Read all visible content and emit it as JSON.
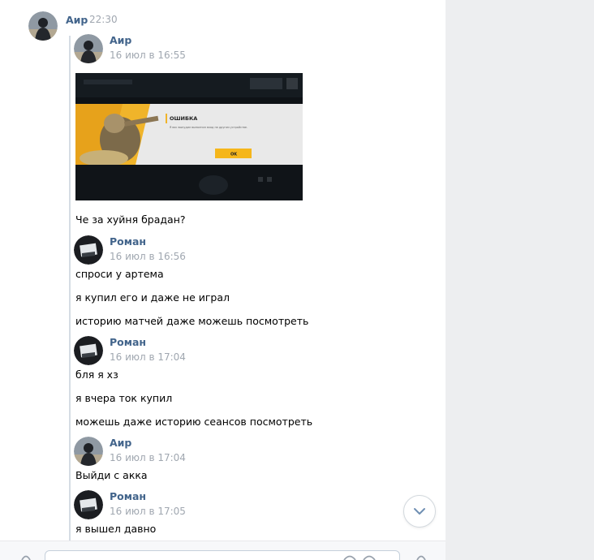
{
  "forward_header": {
    "author": "Аир",
    "time": "22:30"
  },
  "messages": [
    {
      "author": "Аир",
      "date": "16 июл в 16:55",
      "lines": [
        "Че за хуйня брадан?"
      ]
    },
    {
      "author": "Роман",
      "date": "16 июл в 16:56",
      "lines": [
        "спроси у артема",
        "я купил его и даже не играл",
        "историю матчей даже можешь посмотреть"
      ]
    },
    {
      "author": "Роман",
      "date": "16 июл в 17:04",
      "lines": [
        "бля я хз",
        "я вчера ток купил",
        "можешь даже историю сеансов посмотреть"
      ]
    },
    {
      "author": "Аир",
      "date": "16 июл в 17:04",
      "lines": [
        "Выйди с акка"
      ]
    },
    {
      "author": "Роман",
      "date": "16 июл в 17:05",
      "lines": [
        "я вышел давно"
      ]
    }
  ],
  "attachment": {
    "dialog_title": "ОШИБКА",
    "dialog_text": "Я вас вынудил выполнил вход на другом устройстве.",
    "dialog_button": "OK"
  },
  "icons": {
    "scroll_down": "chevron-down-icon",
    "attach": "paperclip-icon",
    "emoji": "smile-icon",
    "voice": "microphone-icon"
  },
  "colors": {
    "author": "#42648b",
    "time": "#a0a7b0",
    "background": "#edeef0",
    "panel": "#ffffff",
    "thread_line": "#d5dce4"
  }
}
